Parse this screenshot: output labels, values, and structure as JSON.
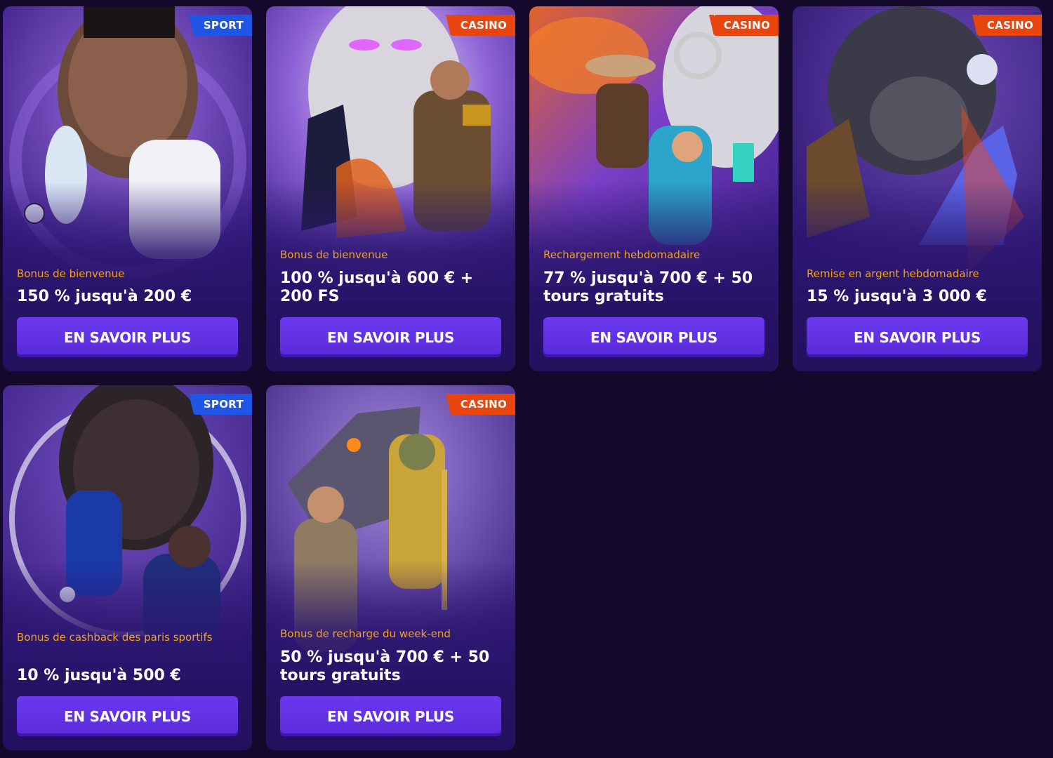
{
  "cards": [
    {
      "badge": "SPORT",
      "badge_type": "sport",
      "subtitle": "Bonus de bienvenue",
      "headline": "150 % jusqu'à 200 €",
      "cta": "EN SAVOIR PLUS"
    },
    {
      "badge": "CASINO",
      "badge_type": "casino",
      "subtitle": "Bonus de bienvenue",
      "headline": "100 % jusqu'à 600 € + 200 FS",
      "cta": "EN SAVOIR PLUS"
    },
    {
      "badge": "CASINO",
      "badge_type": "casino",
      "subtitle": "Rechargement hebdomadaire",
      "headline": "77 % jusqu'à 700 € + 50 tours gratuits",
      "cta": "EN SAVOIR PLUS"
    },
    {
      "badge": "CASINO",
      "badge_type": "casino",
      "subtitle": "Remise en argent hebdomadaire",
      "headline": "15 % jusqu'à 3 000 €",
      "cta": "EN SAVOIR PLUS"
    },
    {
      "badge": "SPORT",
      "badge_type": "sport",
      "subtitle": "Bonus de cashback des paris sportifs",
      "headline": "10 % jusqu'à 500 €",
      "cta": "EN SAVOIR PLUS"
    },
    {
      "badge": "CASINO",
      "badge_type": "casino",
      "subtitle": "Bonus de recharge du week-end",
      "headline": "50 % jusqu'à 700 € + 50 tours gratuits",
      "cta": "EN SAVOIR PLUS"
    }
  ],
  "colors": {
    "background": "#14092b",
    "card": "#2b1670",
    "sport_badge": "#1f56e6",
    "casino_badge": "#e9450f",
    "subtitle": "#f2a21d",
    "button": "#6b39ee"
  }
}
